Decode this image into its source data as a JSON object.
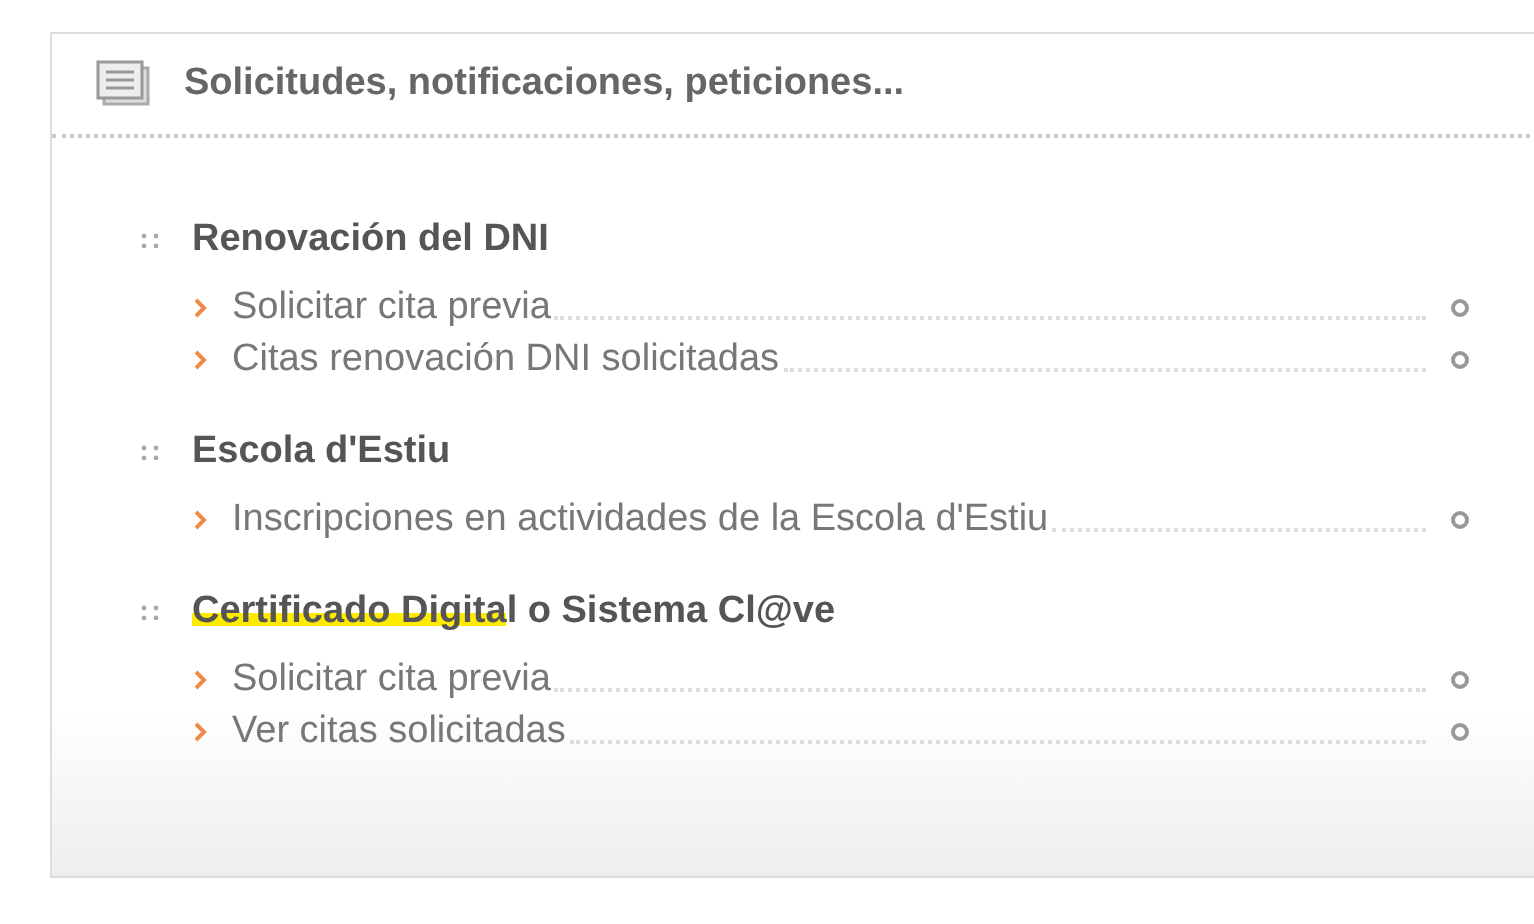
{
  "panel": {
    "title": "Solicitudes, notificaciones, peticiones..."
  },
  "groups": [
    {
      "heading": [
        {
          "text": "Renovación del DNI",
          "highlighted": false
        }
      ],
      "items": [
        "Solicitar cita previa",
        "Citas renovación DNI solicitadas"
      ]
    },
    {
      "heading": [
        {
          "text": "Escola d'Estiu",
          "highlighted": false
        }
      ],
      "items": [
        "Inscripciones en actividades de la Escola d'Estiu"
      ]
    },
    {
      "heading": [
        {
          "text": "Certificado Digita",
          "highlighted": true
        },
        {
          "text": "l o Sistema Cl@ve",
          "highlighted": false
        }
      ],
      "items": [
        "Solicitar cita previa",
        "Ver citas solicitadas"
      ]
    }
  ]
}
